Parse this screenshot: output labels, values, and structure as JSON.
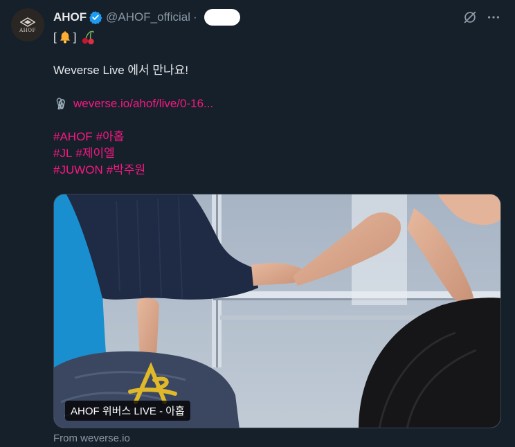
{
  "tweet": {
    "display_name": "AHOF",
    "handle": "@AHOF_official",
    "separator": "·",
    "avatar_logo_text": "AHOF",
    "lines": {
      "line1_open": "[",
      "line1_close": "]",
      "line2": "Weverse Live 에서 만나요!",
      "link": "weverse.io/ahof/live/0-16...",
      "tags1_a": "#AHOF",
      "tags1_b": "#아홉",
      "tags2_a": "#JL",
      "tags2_b": "#제이엘",
      "tags3_a": "#JUWON",
      "tags3_b": "#박주원"
    },
    "emoji": {
      "bell": "bell-emoji",
      "cherries": "cherries-emoji",
      "paperclips": "linked-paperclips-emoji"
    },
    "media": {
      "caption": "AHOF 위버스 LIVE - 아홉"
    },
    "source": "From weverse.io"
  },
  "colors": {
    "background": "#15202b",
    "text": "#e7e9ea",
    "secondary": "#8b98a5",
    "hashtag": "#f91880",
    "verified": "#1d9bf0"
  }
}
